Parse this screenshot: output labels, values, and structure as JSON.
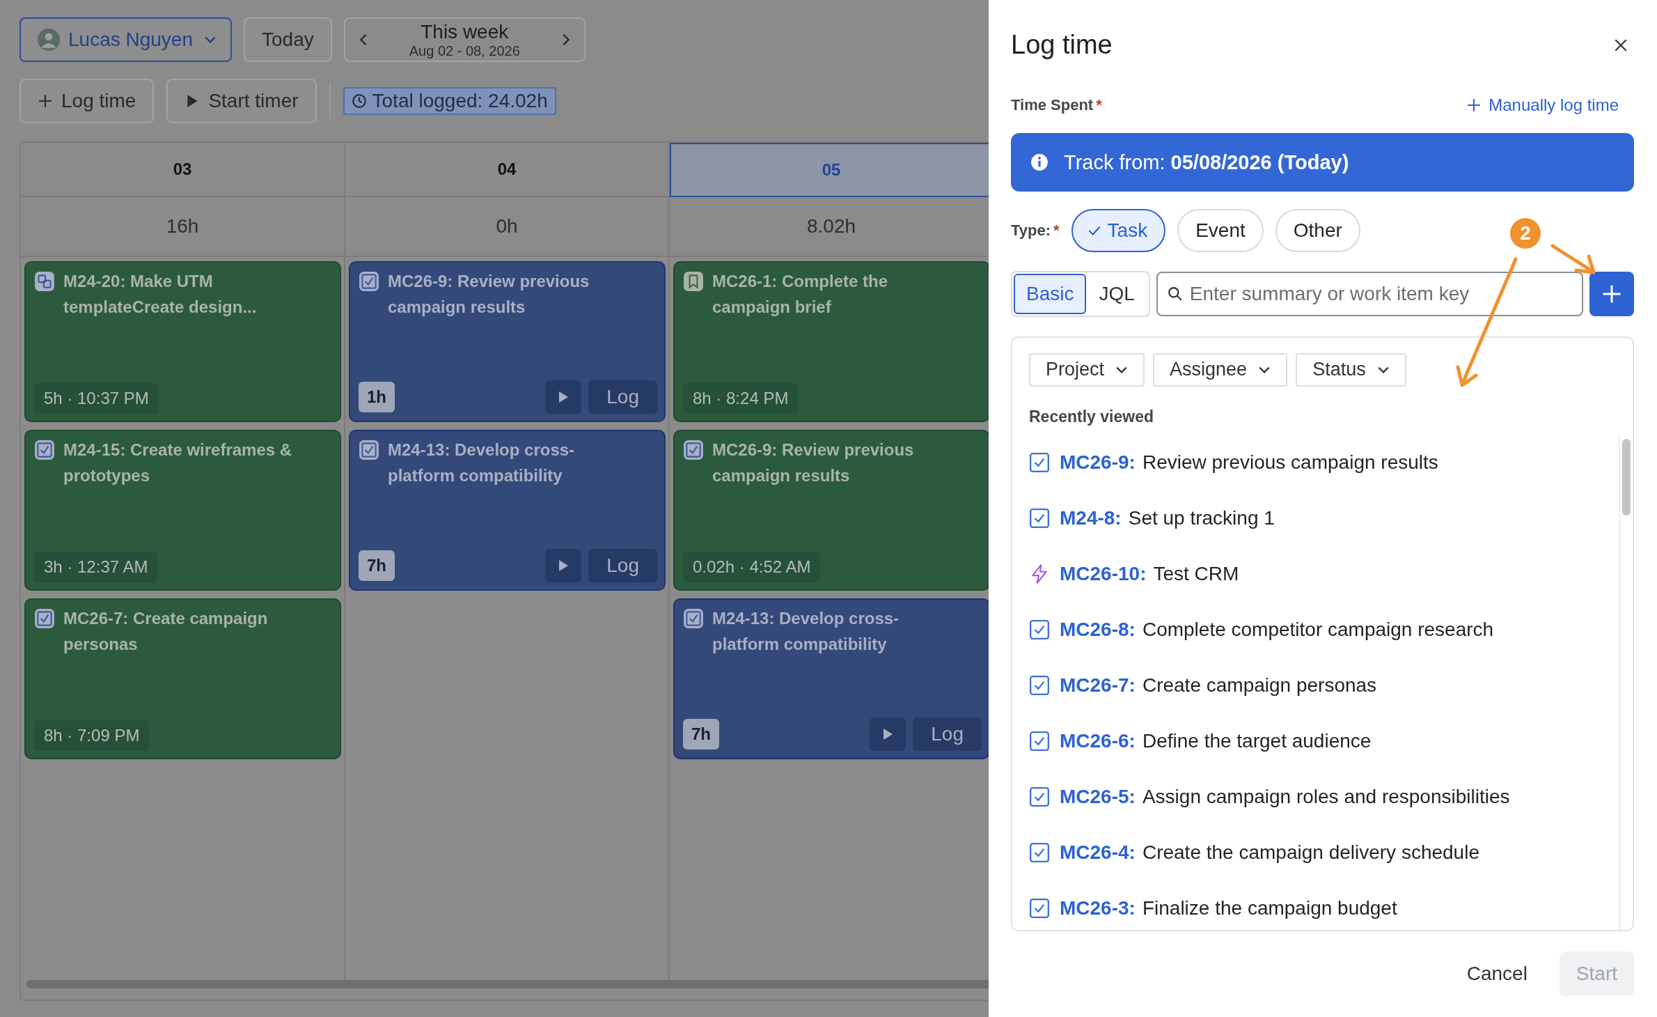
{
  "toolbar": {
    "user": "Lucas Nguyen",
    "today": "Today",
    "week_title": "This week",
    "week_range": "Aug 02 - 08, 2026",
    "log_time": "Log time",
    "start_timer": "Start timer",
    "total_logged": "Total logged: 24.02h"
  },
  "days": [
    {
      "label": "03",
      "selected": false,
      "total": "16h",
      "entries": [
        {
          "kind": "subtask",
          "title": "M24-20: Make UTM templateCreate design...",
          "meta": "5h · 10:37 PM"
        },
        {
          "kind": "task",
          "title": "M24-15: Create wireframes & prototypes",
          "meta": "3h · 12:37 AM"
        },
        {
          "kind": "task",
          "title": "MC26-7: Create campaign personas",
          "meta": "8h · 7:09 PM"
        }
      ]
    },
    {
      "label": "04",
      "selected": false,
      "total": "0h",
      "entries": [
        {
          "kind": "task",
          "title": "MC26-9: Review previous campaign results",
          "meta": "1h",
          "action": "Log"
        },
        {
          "kind": "task",
          "title": "M24-13: Develop cross-platform compatibility",
          "meta": "7h",
          "action": "Log"
        }
      ]
    },
    {
      "label": "05",
      "selected": true,
      "total": "8.02h",
      "entries": [
        {
          "kind": "story",
          "title": "MC26-1: Complete the campaign brief",
          "meta": "8h · 8:24 PM"
        },
        {
          "kind": "task",
          "title": "MC26-9: Review previous campaign results",
          "meta": "0.02h · 4:52 AM"
        },
        {
          "kind": "task",
          "title": "M24-13: Develop cross-platform compatibility",
          "meta": "7h",
          "action": "Log"
        }
      ]
    }
  ],
  "drawer": {
    "title": "Log time",
    "time_spent_label": "Time Spent",
    "required_mark": "*",
    "manual_link": "Manually log time",
    "banner": "Track from: **05/08/2026 (Today)**",
    "type_label": "Type:",
    "type_required_mark": "*",
    "types": [
      {
        "label": "Task",
        "selected": true
      },
      {
        "label": "Event",
        "selected": false
      },
      {
        "label": "Other",
        "selected": false
      }
    ],
    "modes": [
      {
        "label": "Basic",
        "selected": true
      },
      {
        "label": "JQL",
        "selected": false
      }
    ],
    "search": {
      "placeholder": "Enter summary or work item key"
    },
    "filters": [
      "Project",
      "Assignee",
      "Status"
    ],
    "recent_heading": "Recently viewed",
    "items": [
      {
        "kind": "task",
        "key": "MC26-9:",
        "title": "Review previous campaign results"
      },
      {
        "kind": "task",
        "key": "M24-8:",
        "title": "Set up tracking 1"
      },
      {
        "kind": "epic",
        "key": "MC26-10:",
        "title": "Test CRM"
      },
      {
        "kind": "task",
        "key": "MC26-8:",
        "title": "Complete competitor campaign research"
      },
      {
        "kind": "task",
        "key": "MC26-7:",
        "title": "Create campaign personas"
      },
      {
        "kind": "task",
        "key": "MC26-6:",
        "title": "Define the target audience"
      },
      {
        "kind": "task",
        "key": "MC26-5:",
        "title": "Assign campaign roles and responsibilities"
      },
      {
        "kind": "task",
        "key": "MC26-4:",
        "title": "Create the campaign delivery schedule"
      },
      {
        "kind": "task",
        "key": "MC26-3:",
        "title": "Finalize the campaign budget"
      }
    ],
    "cancel": "Cancel",
    "start": {
      "label": "Start",
      "disabled": true
    }
  },
  "annotation": {
    "number": "2"
  }
}
